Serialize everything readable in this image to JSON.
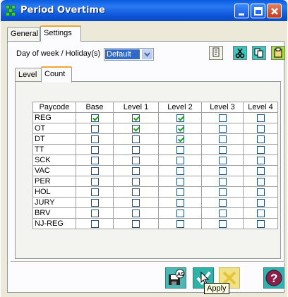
{
  "window": {
    "title": "Period Overtime"
  },
  "outer_tabs": [
    {
      "label": "General",
      "active": false
    },
    {
      "label": "Settings",
      "active": true
    }
  ],
  "day_of_week": {
    "label": "Day of week / Holiday(s)",
    "selected": "Default"
  },
  "inner_tabs": [
    {
      "label": "Level",
      "active": false
    },
    {
      "label": "Count",
      "active": true
    }
  ],
  "grid": {
    "columns": [
      "Paycode",
      "Base",
      "Level 1",
      "Level 2",
      "Level 3",
      "Level 4"
    ],
    "rows": [
      {
        "paycode": "REG",
        "checks": [
          true,
          true,
          true,
          false,
          false
        ]
      },
      {
        "paycode": "OT",
        "checks": [
          false,
          true,
          true,
          false,
          false
        ]
      },
      {
        "paycode": "DT",
        "checks": [
          false,
          false,
          true,
          false,
          false
        ]
      },
      {
        "paycode": "TT",
        "checks": [
          false,
          false,
          false,
          false,
          false
        ]
      },
      {
        "paycode": "SCK",
        "checks": [
          false,
          false,
          false,
          false,
          false
        ]
      },
      {
        "paycode": "VAC",
        "checks": [
          false,
          false,
          false,
          false,
          false
        ]
      },
      {
        "paycode": "PER",
        "checks": [
          false,
          false,
          false,
          false,
          false
        ]
      },
      {
        "paycode": "HOL",
        "checks": [
          false,
          false,
          false,
          false,
          false
        ]
      },
      {
        "paycode": "JURY",
        "checks": [
          false,
          false,
          false,
          false,
          false
        ]
      },
      {
        "paycode": "BRV",
        "checks": [
          false,
          false,
          false,
          false,
          false
        ]
      },
      {
        "paycode": "NJ-REG",
        "checks": [
          false,
          false,
          false,
          false,
          false
        ]
      }
    ]
  },
  "tooltip": "Apply",
  "icons": {
    "toolbar": [
      "document-edit-icon",
      "cut-icon",
      "copy-icon",
      "paste-icon"
    ],
    "footer": [
      "save-as-icon",
      "apply-icon",
      "cancel-icon",
      "help-icon"
    ]
  },
  "colors": {
    "titlebar": "#0a5ce0",
    "panel": "#ece9d8",
    "tab_highlight": "#f2a63a",
    "check": "#21a121",
    "selection": "#316ac5"
  }
}
